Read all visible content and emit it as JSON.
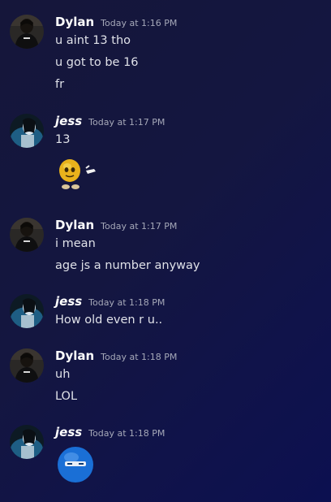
{
  "messages": [
    {
      "author": "Dylan",
      "avatar_icon": "dylan-avatar-icon",
      "timestamp": "Today at 1:16 PM",
      "lines": [
        "u aint 13 tho",
        "u got to be 16",
        "fr"
      ]
    },
    {
      "author": "jess",
      "avatar_icon": "jess-avatar-icon",
      "timestamp": "Today at 1:17 PM",
      "lines": [
        "13"
      ],
      "sticker": "pointing-smiley-emoji-icon"
    },
    {
      "author": "Dylan",
      "avatar_icon": "dylan-avatar-icon",
      "timestamp": "Today at 1:17 PM",
      "lines": [
        "i mean",
        "age js a number anyway"
      ]
    },
    {
      "author": "jess",
      "avatar_icon": "jess-avatar-icon",
      "timestamp": "Today at 1:18 PM",
      "lines": [
        "How old even r u.."
      ]
    },
    {
      "author": "Dylan",
      "avatar_icon": "dylan-avatar-icon",
      "timestamp": "Today at 1:18 PM",
      "lines": [
        "uh",
        "LOL"
      ]
    },
    {
      "author": "jess",
      "avatar_icon": "jess-avatar-icon",
      "timestamp": "Today at 1:18 PM",
      "lines": [],
      "sticker": "blue-squinting-face-emoji-icon"
    }
  ],
  "colors": {
    "background": "#141640",
    "username": "#ffffff",
    "timestamp": "#a5a8b8",
    "message_text": "#dfe1e8"
  }
}
